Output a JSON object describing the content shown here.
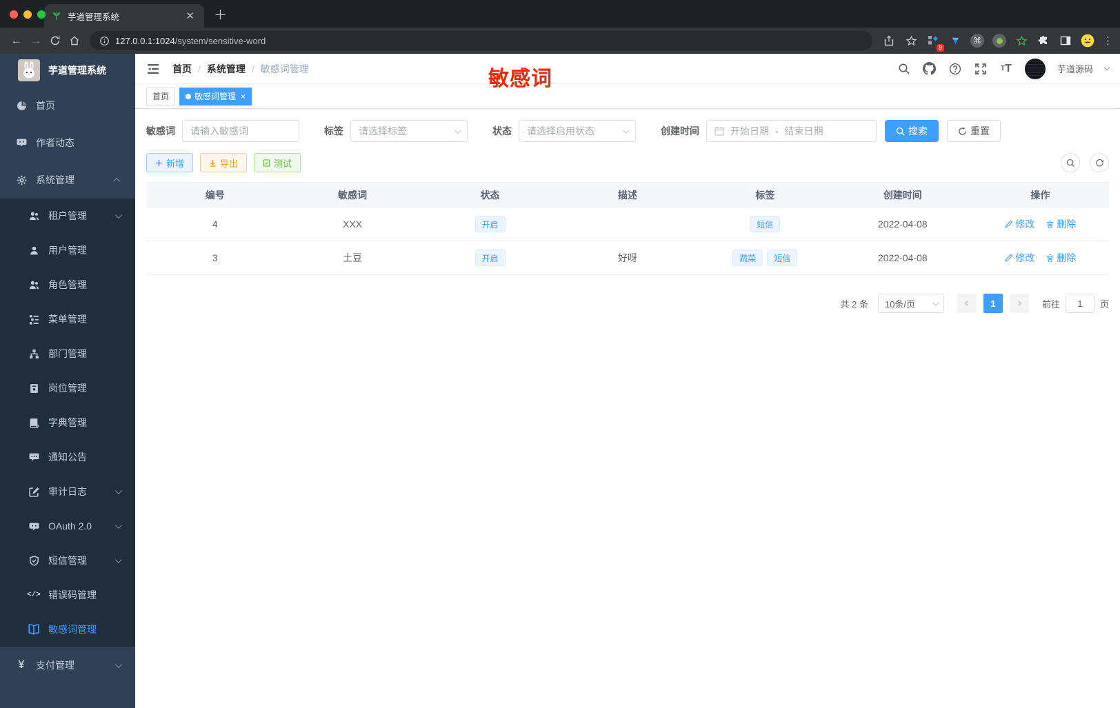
{
  "browser": {
    "tab_title": "芋道管理系统",
    "url_host": "127.0.0.1:1024",
    "url_path": "/system/sensitive-word",
    "extension_badge": "9"
  },
  "sidebar": {
    "app_title": "芋道管理系统",
    "menu": [
      {
        "label": "首页"
      },
      {
        "label": "作者动态"
      },
      {
        "label": "系统管理"
      },
      {
        "label": "租户管理"
      },
      {
        "label": "用户管理"
      },
      {
        "label": "角色管理"
      },
      {
        "label": "菜单管理"
      },
      {
        "label": "部门管理"
      },
      {
        "label": "岗位管理"
      },
      {
        "label": "字典管理"
      },
      {
        "label": "通知公告"
      },
      {
        "label": "审计日志"
      },
      {
        "label": "OAuth 2.0"
      },
      {
        "label": "短信管理"
      },
      {
        "label": "错误码管理"
      },
      {
        "label": "敏感词管理"
      },
      {
        "label": "支付管理"
      }
    ]
  },
  "navbar": {
    "breadcrumb": [
      "首页",
      "系统管理",
      "敏感词管理"
    ],
    "overlay_label": "敏感词",
    "username": "芋道源码"
  },
  "tags": [
    {
      "label": "首页"
    },
    {
      "label": "敏感词管理"
    }
  ],
  "filters": {
    "keyword_label": "敏感词",
    "keyword_placeholder": "请输入敏感词",
    "tag_label": "标签",
    "tag_placeholder": "请选择标签",
    "status_label": "状态",
    "status_placeholder": "请选择启用状态",
    "date_label": "创建时间",
    "date_start_placeholder": "开始日期",
    "date_separator": "-",
    "date_end_placeholder": "结束日期",
    "search_label": "搜索",
    "reset_label": "重置"
  },
  "actions": {
    "add_label": "新增",
    "export_label": "导出",
    "test_label": "测试"
  },
  "table": {
    "columns": [
      "编号",
      "敏感词",
      "状态",
      "描述",
      "标签",
      "创建时间",
      "操作"
    ],
    "edit_label": "修改",
    "delete_label": "删除",
    "rows": [
      {
        "id": "4",
        "word": "XXX",
        "status": "开启",
        "description": "",
        "tags": [
          "短信"
        ],
        "created": "2022-04-08"
      },
      {
        "id": "3",
        "word": "土豆",
        "status": "开启",
        "description": "好呀",
        "tags": [
          "蔬菜",
          "短信"
        ],
        "created": "2022-04-08"
      }
    ]
  },
  "pagination": {
    "total": "共 2 条",
    "page_size": "10条/页",
    "current_page": "1",
    "goto_label": "前往",
    "goto_value": "1",
    "page_unit": "页"
  },
  "colors": {
    "accent": "#409eff",
    "warning": "#e6a23c",
    "success": "#67c23a",
    "overlay_red": "#fb2500",
    "sidebar_bg": "#304156",
    "submenu_bg": "#1f2d3d"
  }
}
